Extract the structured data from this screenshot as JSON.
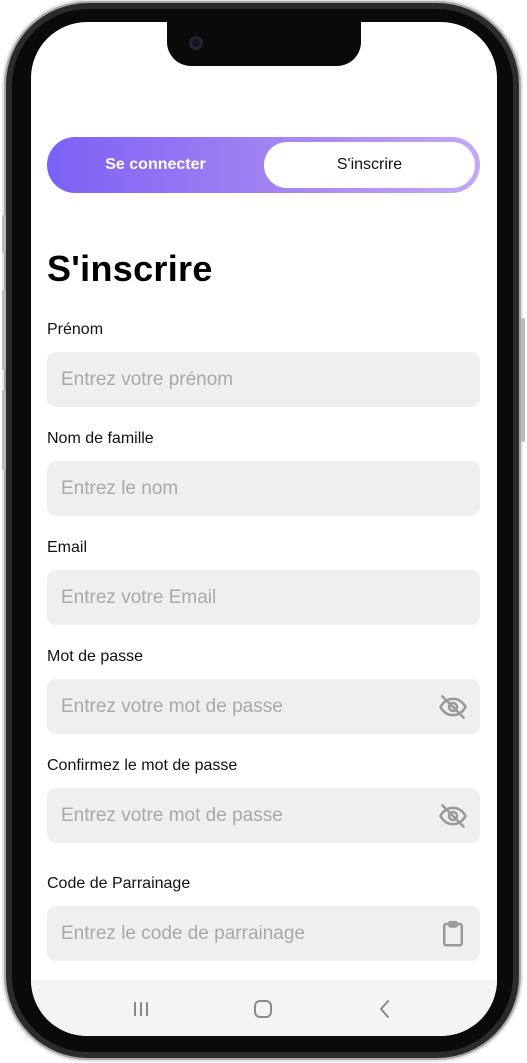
{
  "auth_toggle": {
    "login_label": "Se connecter",
    "signup_label": "S'inscrire",
    "active": "signup",
    "gradient_start": "#7b61f5",
    "gradient_end": "#c4a9f5"
  },
  "page": {
    "title": "S'inscrire"
  },
  "form": {
    "first_name": {
      "label": "Prénom",
      "placeholder": "Entrez votre prénom",
      "value": ""
    },
    "last_name": {
      "label": "Nom de famille",
      "placeholder": "Entrez le nom",
      "value": ""
    },
    "email": {
      "label": "Email",
      "placeholder": "Entrez votre Email",
      "value": ""
    },
    "password": {
      "label": "Mot de passe",
      "placeholder": "Entrez votre mot de passe",
      "value": "",
      "icon": "eye-off-icon"
    },
    "confirm_password": {
      "label": "Confirmez le mot de passe",
      "placeholder": "Entrez votre mot de passe",
      "value": "",
      "icon": "eye-off-icon"
    },
    "referral_code": {
      "label": "Code de Parrainage",
      "placeholder": "Entrez le code de parrainage",
      "value": "",
      "icon": "clipboard-icon"
    }
  },
  "navbar": {
    "icons": [
      "recent-apps-icon",
      "home-icon",
      "back-icon"
    ]
  },
  "colors": {
    "field_background": "#efefef",
    "placeholder": "#a9a9a9",
    "icon": "#9a9a9a"
  }
}
